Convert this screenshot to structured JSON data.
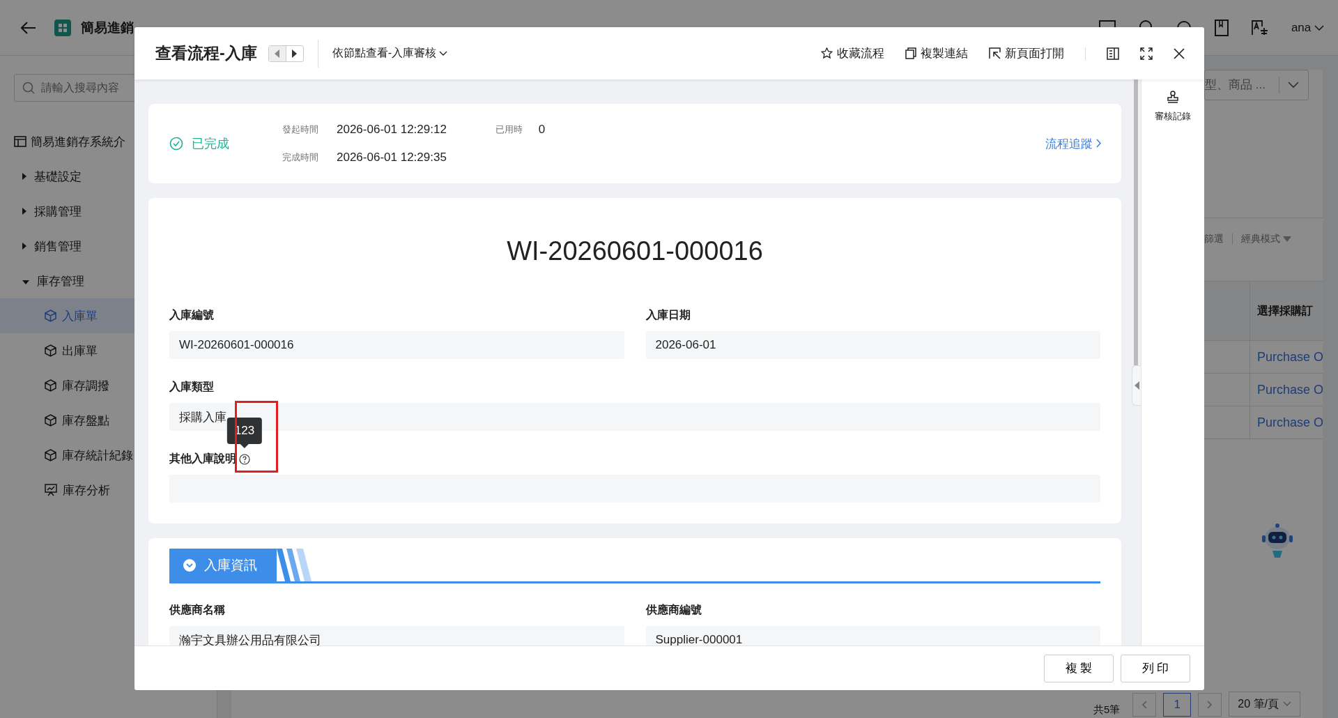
{
  "app_header": {
    "title": "簡易進銷",
    "user": "ana"
  },
  "sidebar": {
    "search_placeholder": "請輸入搜尋內容",
    "items": [
      {
        "label": "簡易進銷存系統介",
        "kind": "page"
      },
      {
        "label": "基礎設定",
        "kind": "group",
        "expanded": false
      },
      {
        "label": "採購管理",
        "kind": "group",
        "expanded": false
      },
      {
        "label": "銷售管理",
        "kind": "group",
        "expanded": false
      },
      {
        "label": "庫存管理",
        "kind": "group",
        "expanded": true,
        "children": [
          {
            "label": "入庫單",
            "kind": "form",
            "selected": true
          },
          {
            "label": "出庫單",
            "kind": "form",
            "selected": false
          },
          {
            "label": "庫存調撥",
            "kind": "form",
            "selected": false
          },
          {
            "label": "庫存盤點",
            "kind": "form",
            "selected": false
          },
          {
            "label": "庫存統計紀錄",
            "kind": "form",
            "selected": false
          },
          {
            "label": "庫存分析",
            "kind": "report",
            "selected": false
          }
        ]
      }
    ]
  },
  "list_view": {
    "search_placeholder": "型、商品 ...",
    "toolbar": [
      "篩選",
      "經典模式"
    ],
    "column_header": "選擇採購訂",
    "rows": [
      "Purchase O",
      "Purchase O",
      "Purchase O"
    ],
    "pagination": {
      "total": "共5筆",
      "pages": [
        {
          "label": "1",
          "selected": true
        }
      ],
      "page_size": "20 筆/頁"
    }
  },
  "modal": {
    "title": "查看流程-入庫",
    "view_selector": "依節點查看-入庫審核",
    "actions": [
      "收藏流程",
      "複製連結",
      "新頁面打開"
    ],
    "status": {
      "label": "已完成",
      "started_label": "發起時間",
      "started": "2026-06-01 12:29:12",
      "finished_label": "完成時間",
      "finished": "2026-06-01 12:29:35",
      "elapsed_label": "已用時",
      "elapsed": "0",
      "trace_link": "流程追蹤"
    },
    "form": {
      "title": "WI-20260601-000016",
      "fields": [
        {
          "label": "入庫編號",
          "value": "WI-20260601-000016",
          "kind": "half"
        },
        {
          "label": "入庫日期",
          "value": "2026-06-01",
          "kind": "half"
        },
        {
          "label": "入庫類型",
          "value": "採購入庫",
          "kind": "full"
        },
        {
          "label": "其他入庫說明",
          "kind": "full",
          "help": true,
          "tooltip": "123",
          "highlighted": true
        }
      ]
    },
    "section": {
      "title": "入庫資訊",
      "expanded": true,
      "fields": [
        {
          "label": "供應商名稱",
          "value": "瀚宇文具辦公用品有限公司"
        },
        {
          "label": "供應商編號",
          "value": "Supplier-000001"
        }
      ]
    },
    "side_panel": {
      "label": "審核記錄"
    },
    "footer_buttons": [
      "複 製",
      "列 印"
    ]
  }
}
